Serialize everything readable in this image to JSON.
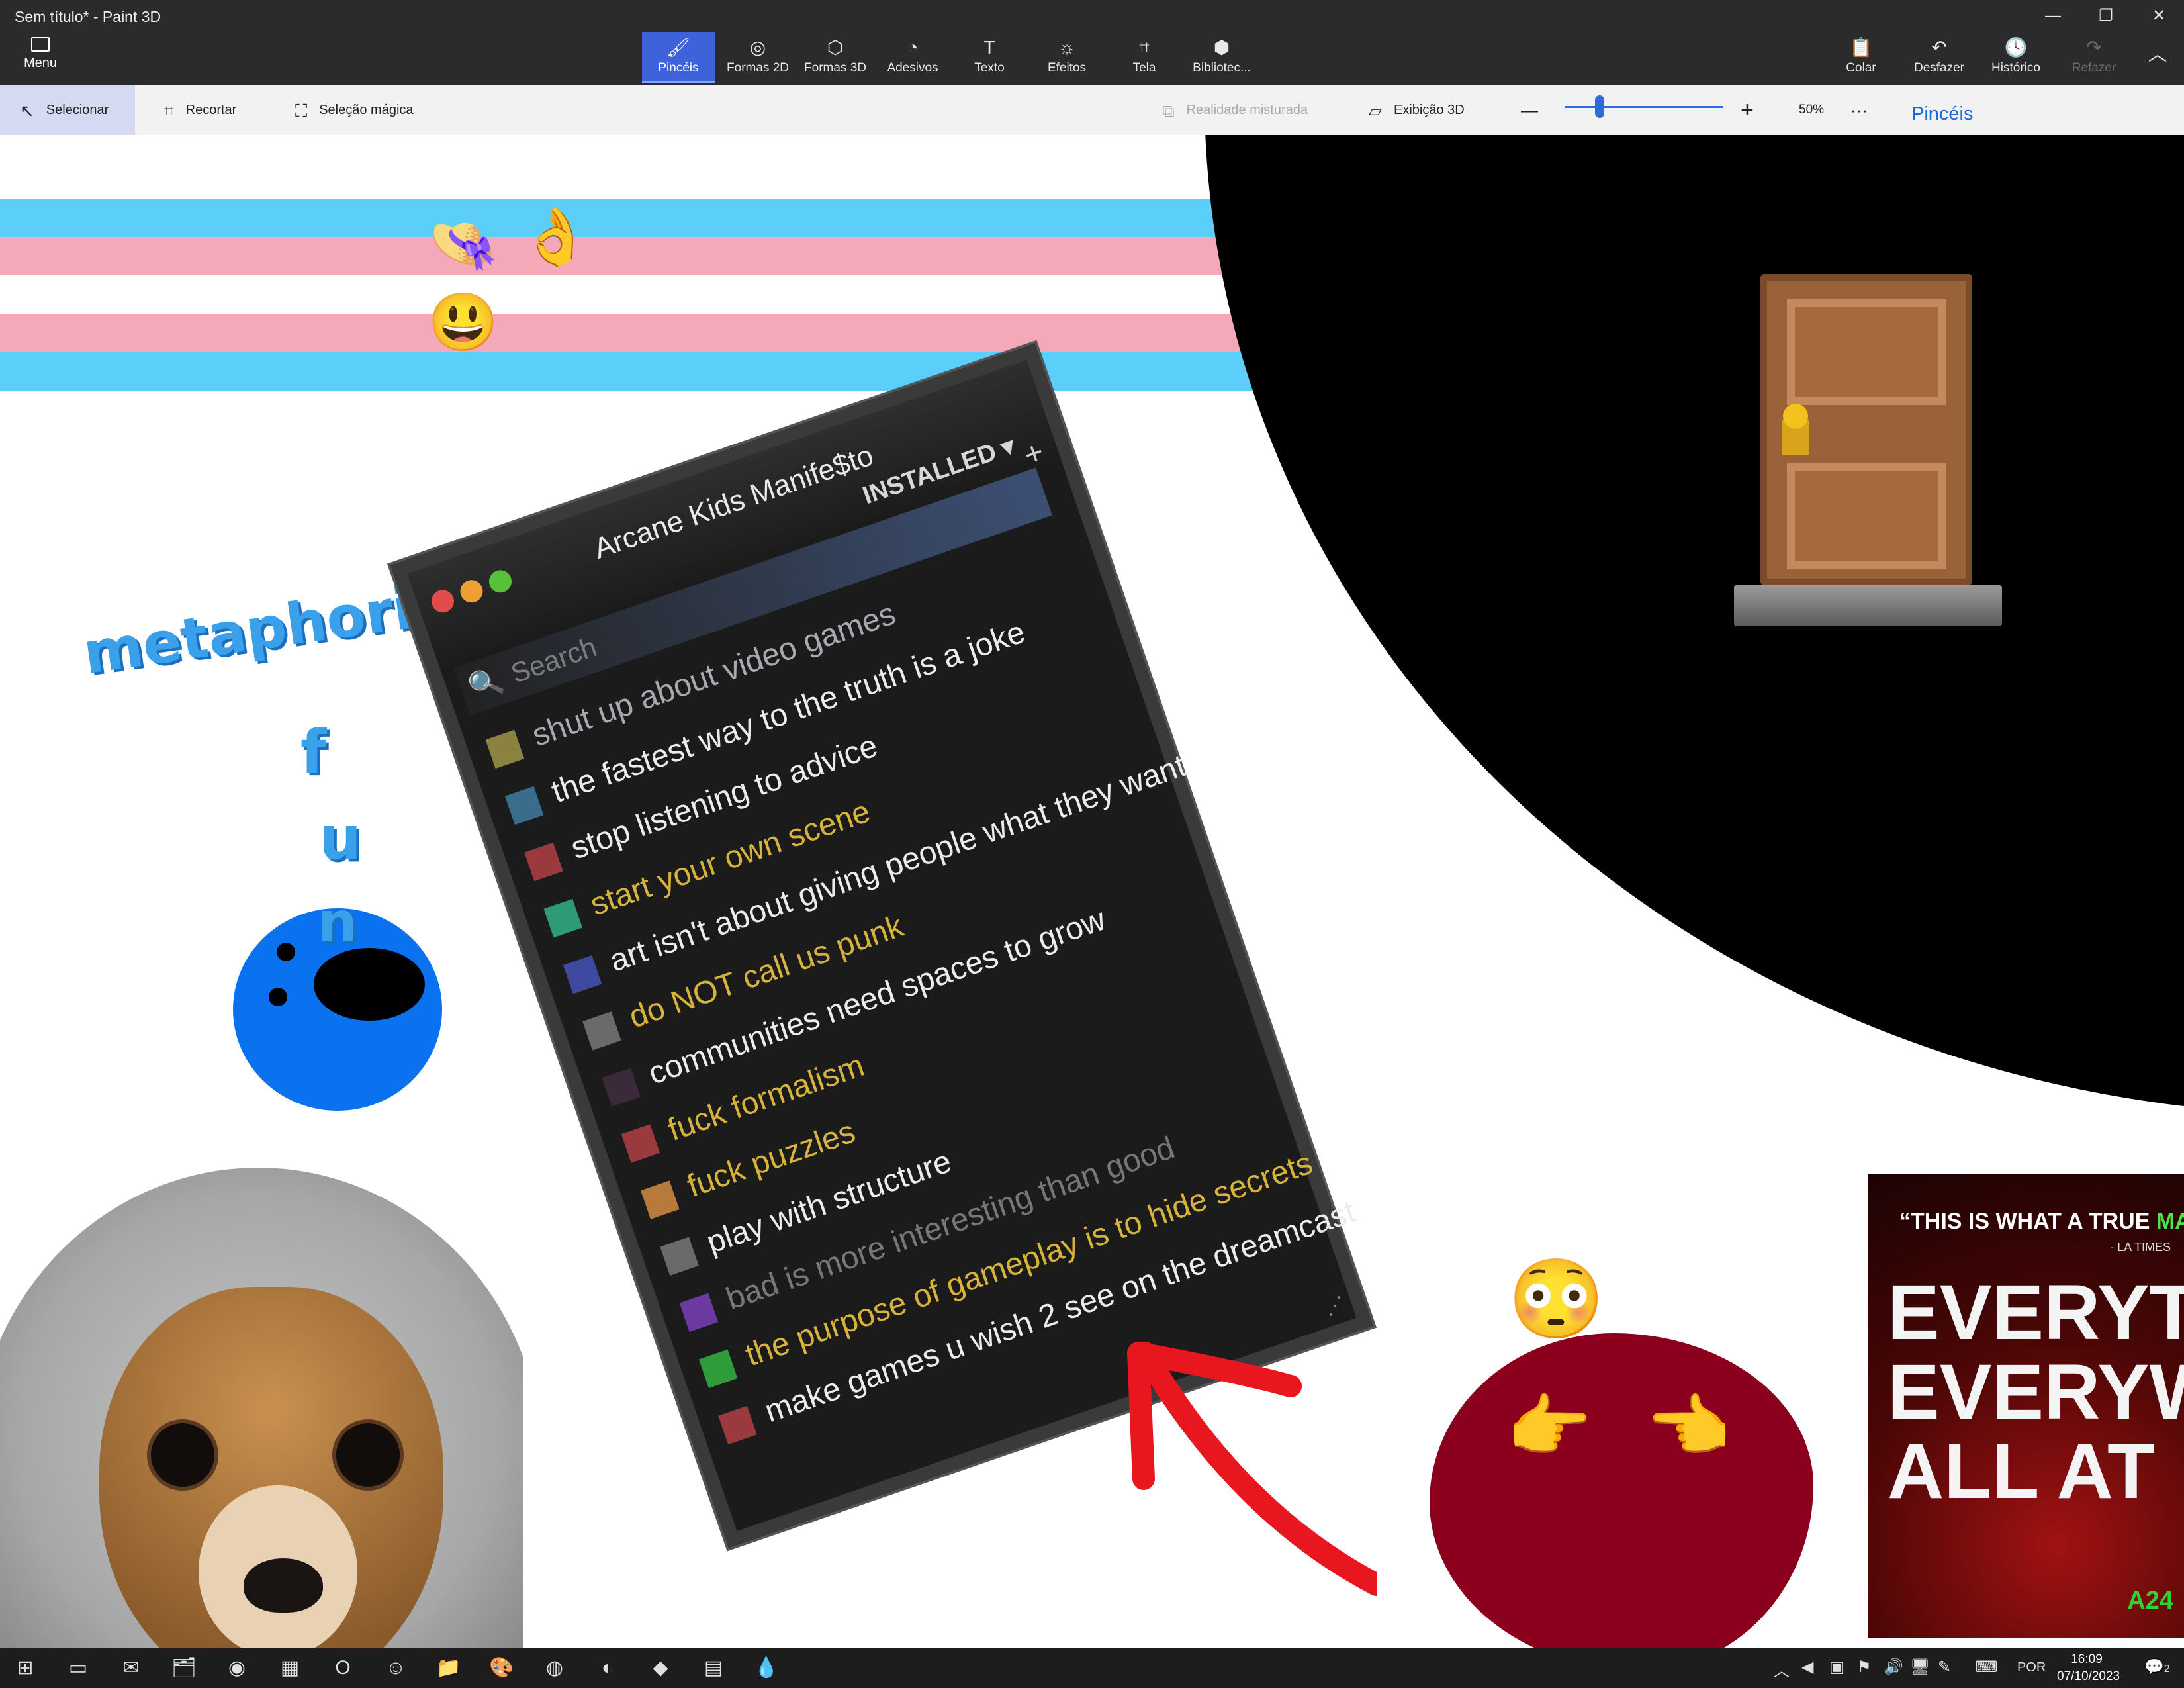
{
  "window": {
    "title": "Sem título* - Paint 3D",
    "controls": [
      "—",
      "❐",
      "✕"
    ]
  },
  "ribbon": {
    "menu_label": "Menu",
    "tools": [
      {
        "label": "Pincéis",
        "icon": "brush-icon",
        "glyph": "🖌"
      },
      {
        "label": "Formas 2D",
        "icon": "shapes-2d-icon",
        "glyph": "◎"
      },
      {
        "label": "Formas 3D",
        "icon": "cube-icon",
        "glyph": "⬡"
      },
      {
        "label": "Adesivos",
        "icon": "sticker-icon",
        "glyph": "◔"
      },
      {
        "label": "Texto",
        "icon": "text-icon",
        "glyph": "T"
      },
      {
        "label": "Efeitos",
        "icon": "effects-icon",
        "glyph": "☼"
      },
      {
        "label": "Tela",
        "icon": "canvas-icon",
        "glyph": "⌗"
      },
      {
        "label": "Bibliotec...",
        "icon": "library-icon",
        "glyph": "⬢"
      }
    ],
    "right": [
      {
        "label": "Colar",
        "icon": "paste-icon",
        "glyph": "📋"
      },
      {
        "label": "Desfazer",
        "icon": "undo-icon",
        "glyph": "↶"
      },
      {
        "label": "Histórico",
        "icon": "history-icon",
        "glyph": "🕓"
      },
      {
        "label": "Refazer",
        "icon": "redo-icon",
        "glyph": "↷"
      }
    ],
    "collapse_glyph": "︿"
  },
  "toolbar": {
    "select": "Selecionar",
    "crop": "Recortar",
    "magic": "Seleção mágica",
    "mixed_reality": "Realidade misturada",
    "view3d": "Exibição 3D",
    "zoom_minus": "—",
    "zoom_plus": "+",
    "zoom_value": 0.5,
    "zoom_label": "50%",
    "more": "···",
    "panel_title": "Pincéis"
  },
  "colors": {
    "stripe_blue": "#5bcefa",
    "stripe_pink": "#f5a9b8",
    "accent": "#3d62d9"
  },
  "canvas": {
    "emojis": {
      "hat": "👒",
      "ok_hand": "👌",
      "smile": "😃",
      "door": "🚪",
      "flushed": "😳",
      "point_right": "👉",
      "point_left": "👈"
    },
    "handwriting": {
      "word": "metaphorically",
      "f": "f",
      "u": "u",
      "n": "n"
    }
  },
  "manifesto": {
    "title": "Arcane Kids Manife$to",
    "status": "INSTALLED",
    "status_arrow": "▾",
    "add": "+",
    "search_placeholder": "Search",
    "search_icon": "🔍",
    "items": [
      {
        "text": "shut up about video games",
        "color": "#a8a8b0",
        "square": "#8b8240"
      },
      {
        "text": "the fastest way to the truth is a joke",
        "color": "#ececec",
        "square": "#3a6c8c"
      },
      {
        "text": "stop listening to advice",
        "color": "#ececec",
        "square": "#9b3a3e"
      },
      {
        "text": "start your own scene",
        "color": "#d8b33a",
        "square": "#2f9b74"
      },
      {
        "text": "art isn't about giving people what they want",
        "color": "#ececec",
        "square": "#3d4aa0"
      },
      {
        "text": "do NOT call us punk",
        "color": "#d8b33a",
        "square": "#6a6a6a"
      },
      {
        "text": "communities need spaces to grow",
        "color": "#ececec",
        "square": "#3b2a3a"
      },
      {
        "text": "fuck formalism",
        "color": "#d8b33a",
        "square": "#9b3a3e"
      },
      {
        "text": "fuck puzzles",
        "color": "#d8b33a",
        "square": "#b77a3a"
      },
      {
        "text": "play with structure",
        "color": "#ececec",
        "square": "#6a6a6a"
      },
      {
        "text": "bad is more interesting than good",
        "color": "#777777",
        "square": "#6a3aa0"
      },
      {
        "text": "the purpose of gameplay is to hide secrets",
        "color": "#d8b33a",
        "square": "#2f9b3a"
      },
      {
        "text": "make games u wish 2 see on the dreamcast",
        "color": "#ececec",
        "square": "#9b3a3e"
      }
    ]
  },
  "poster": {
    "quote_open": "“",
    "quote_text": "THIS IS WHAT A TRUE ",
    "quote_highlight": "MAST",
    "source": "- LA TIMES",
    "line1": "EVERYT",
    "line2": "EVERYW",
    "line3": "ALL AT",
    "brand": "A24"
  },
  "taskbar": {
    "apps": [
      {
        "icon": "windows-start-icon",
        "glyph": "⊞"
      },
      {
        "icon": "task-view-icon",
        "glyph": "▭"
      },
      {
        "icon": "mail-icon",
        "glyph": "✉"
      },
      {
        "icon": "files-icon",
        "glyph": "🗂"
      },
      {
        "icon": "steam-icon",
        "glyph": "◉"
      },
      {
        "icon": "photos-icon",
        "glyph": "▦"
      },
      {
        "icon": "opera-icon",
        "glyph": "O"
      },
      {
        "icon": "discord-icon",
        "glyph": "☺"
      },
      {
        "icon": "folder-icon",
        "glyph": "📁"
      },
      {
        "icon": "paint-icon",
        "glyph": "🎨"
      },
      {
        "icon": "firefox-icon",
        "glyph": "◍"
      },
      {
        "icon": "github-icon",
        "glyph": "◐"
      },
      {
        "icon": "app-icon",
        "glyph": "◆"
      },
      {
        "icon": "winrar-icon",
        "glyph": "▤"
      },
      {
        "icon": "paint3d-icon",
        "glyph": "💧"
      }
    ],
    "tray": [
      "︿",
      "◀",
      "▣",
      "⚑",
      "🔊",
      "🖥",
      "✎",
      "⌨"
    ],
    "lang": "POR",
    "time": "16:09",
    "date": "07/10/2023",
    "notif": "2"
  }
}
